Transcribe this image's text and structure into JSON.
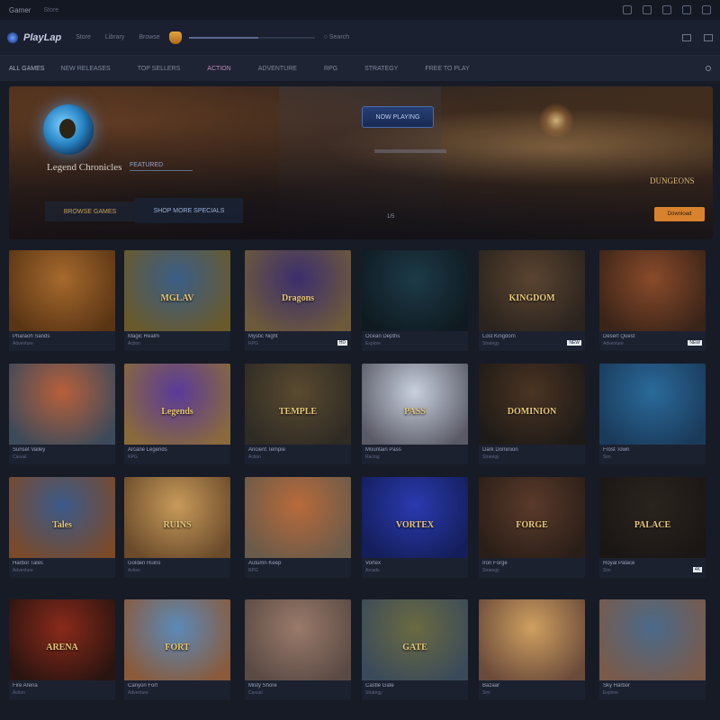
{
  "titlebar": {
    "title": "Gamer",
    "subtitle": "Store"
  },
  "nav": {
    "logo": "PlayLap",
    "links": [
      "Store",
      "Library",
      "Browse"
    ],
    "search_hint": "Search",
    "progress_level": 0.55
  },
  "filters": [
    "ALL GAMES",
    "NEW RELEASES",
    "TOP SELLERS",
    "ACTION",
    "ADVENTURE",
    "RPG",
    "STRATEGY",
    "FREE TO PLAY"
  ],
  "hero": {
    "title": "Legend Chronicles",
    "tag": "FEATURED",
    "left_button": "BROWSE GAMES",
    "left_button2": "SHOP MORE SPECIALS",
    "center_button": "NOW PLAYING",
    "pager": "1/5",
    "right_title": "DUNGEONS",
    "cta": "Download",
    "colors": {
      "cta": "#d8822e",
      "accent": "#2a86c6"
    }
  },
  "cards": [
    {
      "title": "Pharaoh Sands",
      "sub": "Adventure",
      "logo": "",
      "g": [
        "#a6692d",
        "#5a3514"
      ]
    },
    {
      "title": "Magic Realm",
      "sub": "Action",
      "logo": "MGLAV",
      "g": [
        "#3a5e88",
        "#6a5a2a"
      ]
    },
    {
      "title": "Mystic Night",
      "sub": "RPG",
      "logo": "Dragons",
      "g": [
        "#3b2e6e",
        "#6e5a3a"
      ],
      "badge": "HD"
    },
    {
      "title": "Ocean Depths",
      "sub": "Explore",
      "logo": "",
      "g": [
        "#1d3a48",
        "#0f1a20"
      ]
    },
    {
      "title": "Lost Kingdom",
      "sub": "Strategy",
      "logo": "KINGDOM",
      "g": [
        "#5a4430",
        "#2a231e"
      ],
      "badge": "NEW"
    },
    {
      "title": "Desert Quest",
      "sub": "Adventure",
      "logo": "",
      "g": [
        "#8a4a2a",
        "#3a2418"
      ],
      "badge": "NEW"
    },
    {
      "title": "Sunset Valley",
      "sub": "Casual",
      "logo": "",
      "g": [
        "#b8603a",
        "#3c4a5a"
      ]
    },
    {
      "title": "Arcane Legends",
      "sub": "RPG",
      "logo": "Legends",
      "g": [
        "#5a3a9a",
        "#8a6a3a"
      ]
    },
    {
      "title": "Ancient Temple",
      "sub": "Action",
      "logo": "TEMPLE",
      "g": [
        "#5a4a30",
        "#2e2a24"
      ]
    },
    {
      "title": "Mountain Pass",
      "sub": "Racing",
      "logo": "PASS",
      "g": [
        "#c8d0de",
        "#5a5a66"
      ]
    },
    {
      "title": "Dark Dominion",
      "sub": "Strategy",
      "logo": "DOMINION",
      "g": [
        "#4a3422",
        "#1e1a18"
      ]
    },
    {
      "title": "Frost Town",
      "sub": "Sim",
      "logo": "",
      "g": [
        "#2a6a9a",
        "#1a3a5a"
      ]
    },
    {
      "title": "Harbor Tales",
      "sub": "Adventure",
      "logo": "Tales",
      "g": [
        "#3a5a8a",
        "#7a4a2a"
      ]
    },
    {
      "title": "Golden Ruins",
      "sub": "Action",
      "logo": "RUINS",
      "g": [
        "#c89a5a",
        "#6a4a2a"
      ]
    },
    {
      "title": "Autumn Keep",
      "sub": "RPG",
      "logo": "",
      "g": [
        "#b86a3a",
        "#6a5a4a"
      ]
    },
    {
      "title": "Vortex",
      "sub": "Arcade",
      "logo": "VORTEX",
      "g": [
        "#2a3ab0",
        "#141e5a"
      ]
    },
    {
      "title": "Iron Forge",
      "sub": "Strategy",
      "logo": "FORGE",
      "g": [
        "#5a3a2a",
        "#2a1e18"
      ]
    },
    {
      "title": "Royal Palace",
      "sub": "Sim",
      "logo": "PALACE",
      "g": [
        "#2a241e",
        "#1a1614"
      ],
      "badge": "4K"
    },
    {
      "title": "Fire Arena",
      "sub": "Action",
      "logo": "ARENA",
      "g": [
        "#8a2a1a",
        "#2a1410"
      ]
    },
    {
      "title": "Canyon Fort",
      "sub": "Adventure",
      "logo": "FORT",
      "g": [
        "#5a8ab8",
        "#8a5a3a"
      ]
    },
    {
      "title": "Misty Shore",
      "sub": "Casual",
      "logo": "",
      "g": [
        "#9a7a6a",
        "#5a4a44"
      ]
    },
    {
      "title": "Castle Gate",
      "sub": "Strategy",
      "logo": "GATE",
      "g": [
        "#6a6a40",
        "#3a4a5a"
      ]
    },
    {
      "title": "Bazaar",
      "sub": "Sim",
      "logo": "",
      "g": [
        "#d0a060",
        "#6a4a3a"
      ]
    },
    {
      "title": "Sky Harbor",
      "sub": "Explore",
      "logo": "",
      "g": [
        "#4a6a8a",
        "#7a5a4a"
      ]
    }
  ]
}
